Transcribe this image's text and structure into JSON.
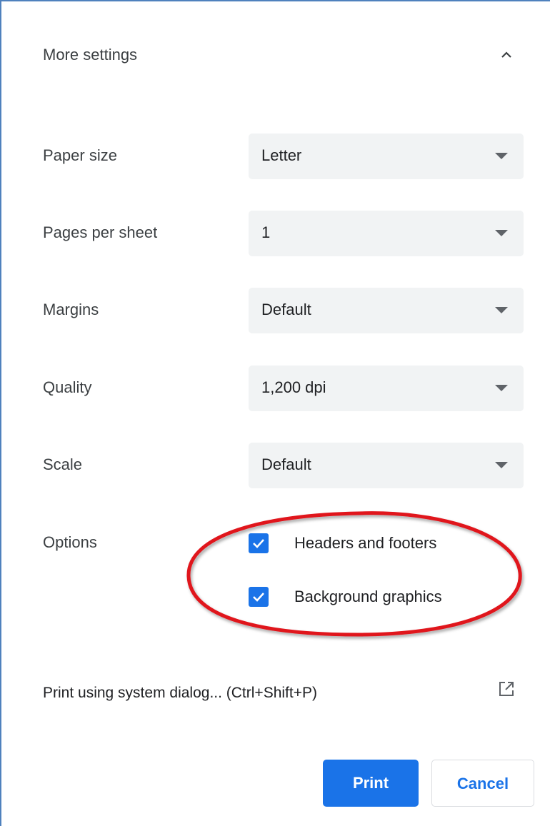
{
  "section": {
    "title": "More settings",
    "collapse_icon": "chevron-up-icon"
  },
  "settings": [
    {
      "label": "Paper size",
      "value": "Letter"
    },
    {
      "label": "Pages per sheet",
      "value": "1"
    },
    {
      "label": "Margins",
      "value": "Default"
    },
    {
      "label": "Quality",
      "value": "1,200 dpi"
    },
    {
      "label": "Scale",
      "value": "Default"
    }
  ],
  "options": {
    "label": "Options",
    "items": [
      {
        "label": "Headers and footers",
        "checked": true
      },
      {
        "label": "Background graphics",
        "checked": true
      }
    ]
  },
  "system_dialog": {
    "label": "Print using system dialog... (Ctrl+Shift+P)",
    "icon": "open-external-icon"
  },
  "buttons": {
    "print": "Print",
    "cancel": "Cancel"
  },
  "colors": {
    "accent": "#1a73e8",
    "select_bg": "#f1f3f4",
    "annotation": "#e0141e",
    "frame_border": "#4f81bd"
  }
}
